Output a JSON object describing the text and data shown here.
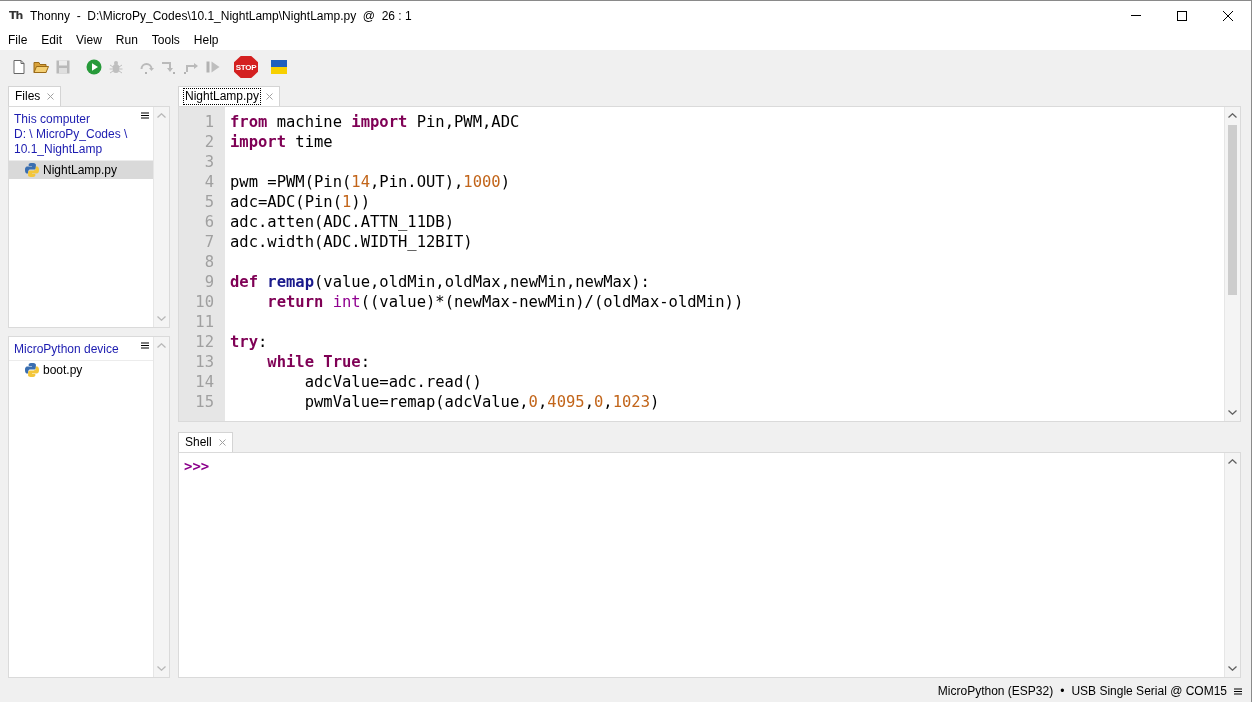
{
  "window": {
    "logo": "Th",
    "title": "Thonny  -  D:\\MicroPy_Codes\\10.1_NightLamp\\NightLamp.py  @  26 : 1"
  },
  "menu": [
    "File",
    "Edit",
    "View",
    "Run",
    "Tools",
    "Help"
  ],
  "toolbar": {
    "groups": [
      {
        "items": [
          {
            "kind": "new",
            "disabled": false
          },
          {
            "kind": "open",
            "disabled": false
          },
          {
            "kind": "save",
            "disabled": true
          }
        ]
      },
      {
        "items": [
          {
            "kind": "run",
            "disabled": false
          },
          {
            "kind": "debug",
            "disabled": true
          }
        ]
      },
      {
        "items": [
          {
            "kind": "step_over",
            "disabled": true
          },
          {
            "kind": "step_into",
            "disabled": true
          },
          {
            "kind": "step_out",
            "disabled": true
          },
          {
            "kind": "resume",
            "disabled": true
          }
        ]
      },
      {
        "items": [
          {
            "kind": "stop",
            "disabled": false,
            "label": "STOP"
          }
        ]
      },
      {
        "items": [
          {
            "kind": "flag",
            "disabled": false
          }
        ]
      }
    ]
  },
  "files_panel": {
    "tabs": [
      {
        "label": "Files",
        "selected": true,
        "focused": false
      }
    ],
    "sections": [
      {
        "title": "This computer",
        "path": "D: \\ MicroPy_Codes \\ 10.1_NightLamp",
        "items": [
          {
            "name": "NightLamp.py",
            "selected": true
          }
        ]
      },
      {
        "title": "MicroPython device",
        "items": [
          {
            "name": "boot.py",
            "selected": false
          }
        ]
      }
    ]
  },
  "editor": {
    "tabs": [
      {
        "label": "NightLamp.py",
        "selected": true,
        "focused": true
      }
    ],
    "lines": [
      {
        "number": "1",
        "tokens": [
          {
            "kind": "keyword",
            "text": "from"
          },
          {
            "kind": "plain",
            "text": " machine "
          },
          {
            "kind": "keyword",
            "text": "import"
          },
          {
            "kind": "plain",
            "text": " Pin,PWM,ADC"
          }
        ]
      },
      {
        "number": "2",
        "tokens": [
          {
            "kind": "keyword",
            "text": "import"
          },
          {
            "kind": "plain",
            "text": " time"
          }
        ]
      },
      {
        "number": "3"
      },
      {
        "number": "4",
        "tokens": [
          {
            "kind": "plain",
            "text": "pwm =PWM(Pin("
          },
          {
            "kind": "number",
            "text": "14"
          },
          {
            "kind": "plain",
            "text": ",Pin.OUT),"
          },
          {
            "kind": "number",
            "text": "1000"
          },
          {
            "kind": "plain",
            "text": ")"
          }
        ]
      },
      {
        "number": "5",
        "tokens": [
          {
            "kind": "plain",
            "text": "adc=ADC(Pin("
          },
          {
            "kind": "number",
            "text": "1"
          },
          {
            "kind": "plain",
            "text": "))"
          }
        ]
      },
      {
        "number": "6",
        "tokens": [
          {
            "kind": "plain",
            "text": "adc.atten(ADC.ATTN_11DB)"
          }
        ]
      },
      {
        "number": "7",
        "tokens": [
          {
            "kind": "plain",
            "text": "adc.width(ADC.WIDTH_12BIT)"
          }
        ]
      },
      {
        "number": "8"
      },
      {
        "number": "9",
        "tokens": [
          {
            "kind": "keyword",
            "text": "def "
          },
          {
            "kind": "defname",
            "text": "remap"
          },
          {
            "kind": "plain",
            "text": "(value,oldMin,oldMax,newMin,newMax):"
          }
        ]
      },
      {
        "number": "10",
        "tokens": [
          {
            "kind": "keyword",
            "text": "    return "
          },
          {
            "kind": "builtin",
            "text": "int"
          },
          {
            "kind": "plain",
            "text": "((value)*(newMax-newMin)/(oldMax-oldMin))"
          }
        ]
      },
      {
        "number": "11"
      },
      {
        "number": "12",
        "tokens": [
          {
            "kind": "keyword",
            "text": "try"
          },
          {
            "kind": "plain",
            "text": ":"
          }
        ]
      },
      {
        "number": "13",
        "tokens": [
          {
            "kind": "keyword",
            "text": "    while True"
          },
          {
            "kind": "plain",
            "text": ":"
          }
        ]
      },
      {
        "number": "14",
        "tokens": [
          {
            "kind": "plain",
            "text": "        adcValue=adc.read()"
          }
        ]
      },
      {
        "number": "15",
        "tokens": [
          {
            "kind": "plain",
            "text": "        pwmValue=remap(adcValue,"
          },
          {
            "kind": "number",
            "text": "0"
          },
          {
            "kind": "plain",
            "text": ","
          },
          {
            "kind": "number",
            "text": "4095"
          },
          {
            "kind": "plain",
            "text": ","
          },
          {
            "kind": "number",
            "text": "0"
          },
          {
            "kind": "plain",
            "text": ","
          },
          {
            "kind": "number",
            "text": "1023"
          },
          {
            "kind": "plain",
            "text": ")"
          }
        ]
      }
    ]
  },
  "shell": {
    "tabs": [
      {
        "label": "Shell",
        "selected": true,
        "focused": false
      }
    ],
    "prompt": ">>>"
  },
  "status_bar": {
    "interpreter": "MicroPython (ESP32)",
    "separator": "•",
    "port": "USB Single Serial @ COM15"
  }
}
